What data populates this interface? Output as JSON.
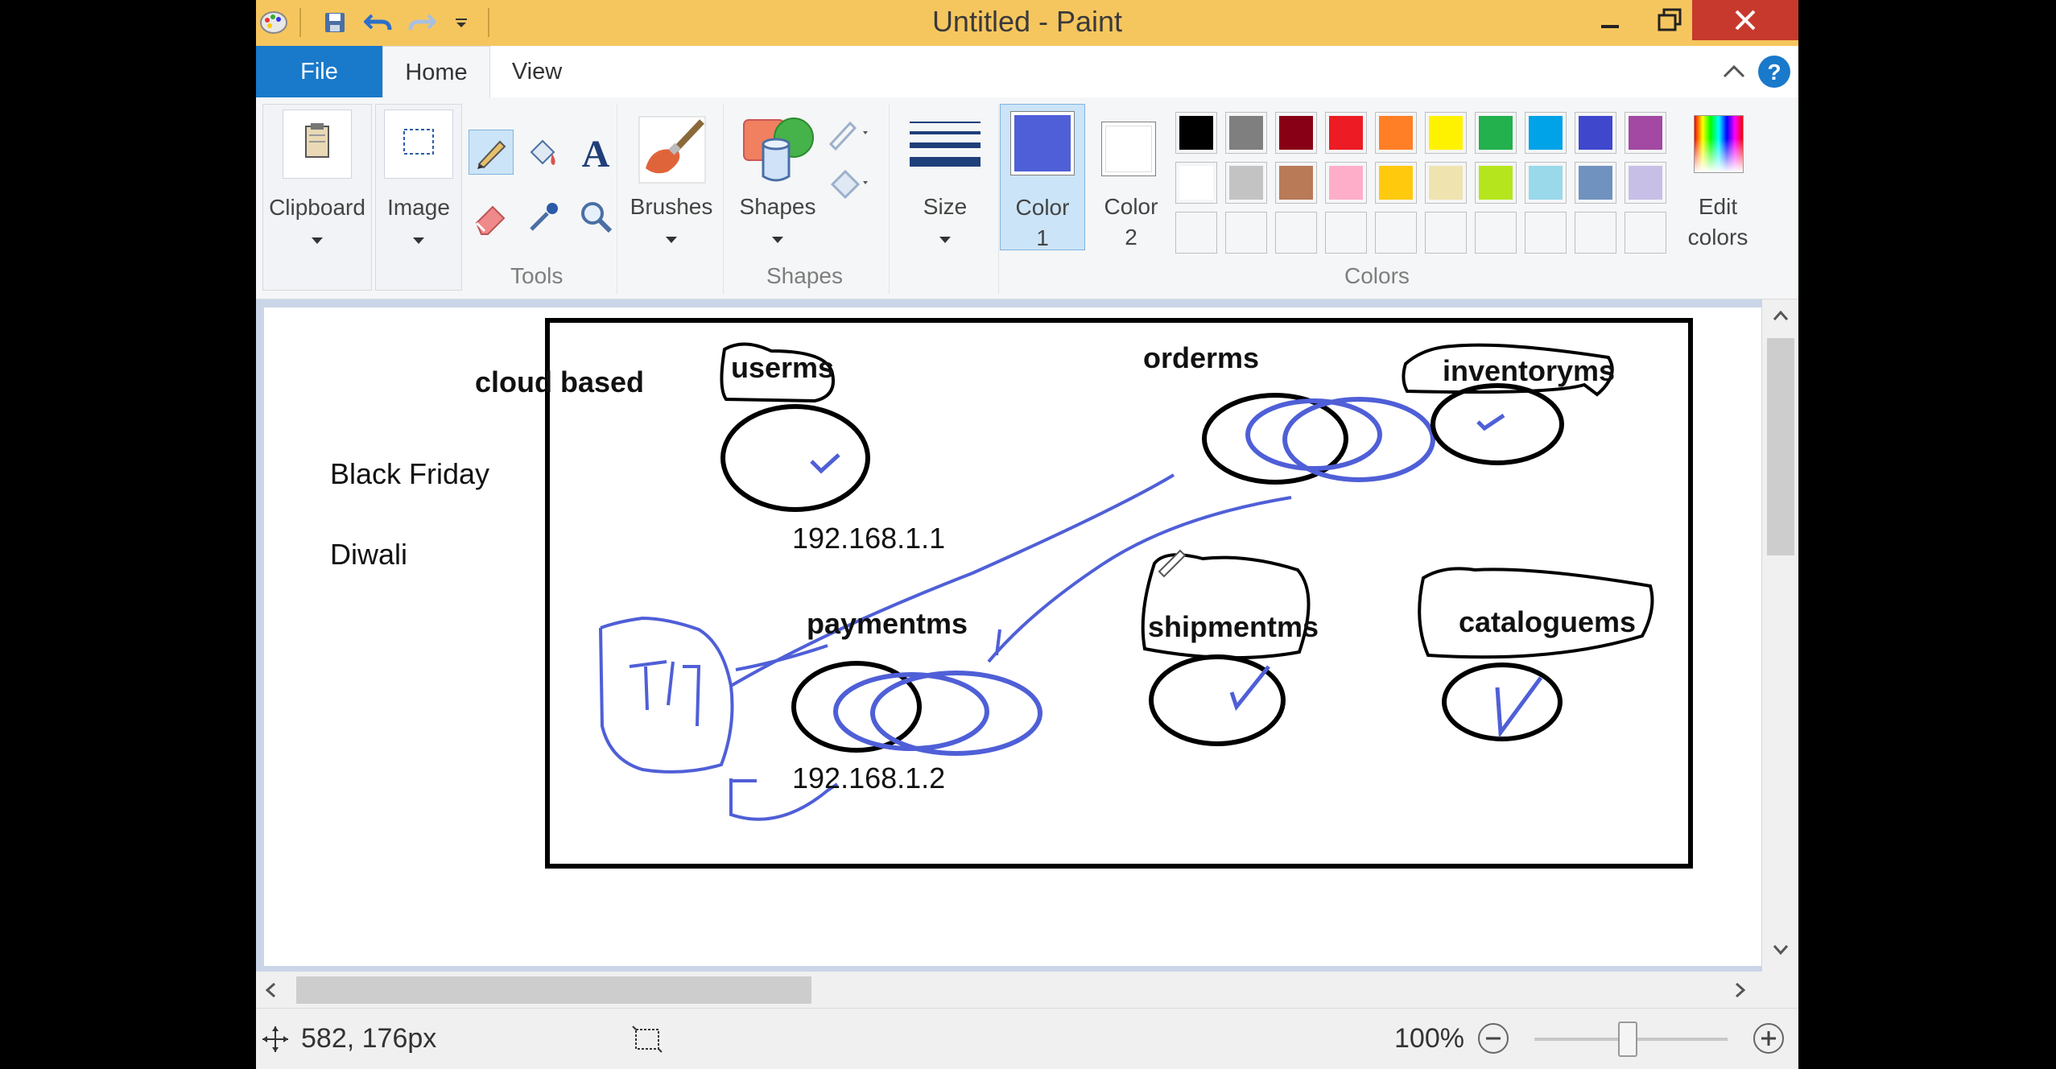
{
  "app": {
    "title": "Untitled - Paint"
  },
  "tabs": {
    "file": "File",
    "home": "Home",
    "view": "View"
  },
  "ribbon": {
    "clipboard": "Clipboard",
    "image": "Image",
    "tools": "Tools",
    "brushes": "Brushes",
    "shapes_btn": "Shapes",
    "shapes_group": "Shapes",
    "size": "Size",
    "color1_a": "Color",
    "color1_b": "1",
    "color2_a": "Color",
    "color2_b": "2",
    "colors_group": "Colors",
    "edit_colors_a": "Edit",
    "edit_colors_b": "colors"
  },
  "colors": {
    "active_color1": "#4f5fd7",
    "active_color2": "#ffffff",
    "row1": [
      "#000000",
      "#7f7f7f",
      "#880015",
      "#ed1c24",
      "#ff7f27",
      "#fff200",
      "#22b14c",
      "#00a2e8",
      "#3f48cc",
      "#a349a4"
    ],
    "row2": [
      "#ffffff",
      "#c3c3c3",
      "#b97a57",
      "#ffaec9",
      "#ffc90e",
      "#efe4b0",
      "#b5e61d",
      "#99d9ea",
      "#7092be",
      "#c8bfe7"
    ]
  },
  "canvas": {
    "cloud_based": "cloud based",
    "black_friday": "Black Friday",
    "diwali": "Diwali",
    "userms": "userms",
    "orderms": "orderms",
    "inventoryms": "inventoryms",
    "ip1": "192.168.1.1",
    "paymentms": "paymentms",
    "shipmentms": "shipmentms",
    "cataloguems": "cataloguems",
    "ip2": "192.168.1.2"
  },
  "status": {
    "coords": "582, 176px",
    "zoom": "100%"
  }
}
